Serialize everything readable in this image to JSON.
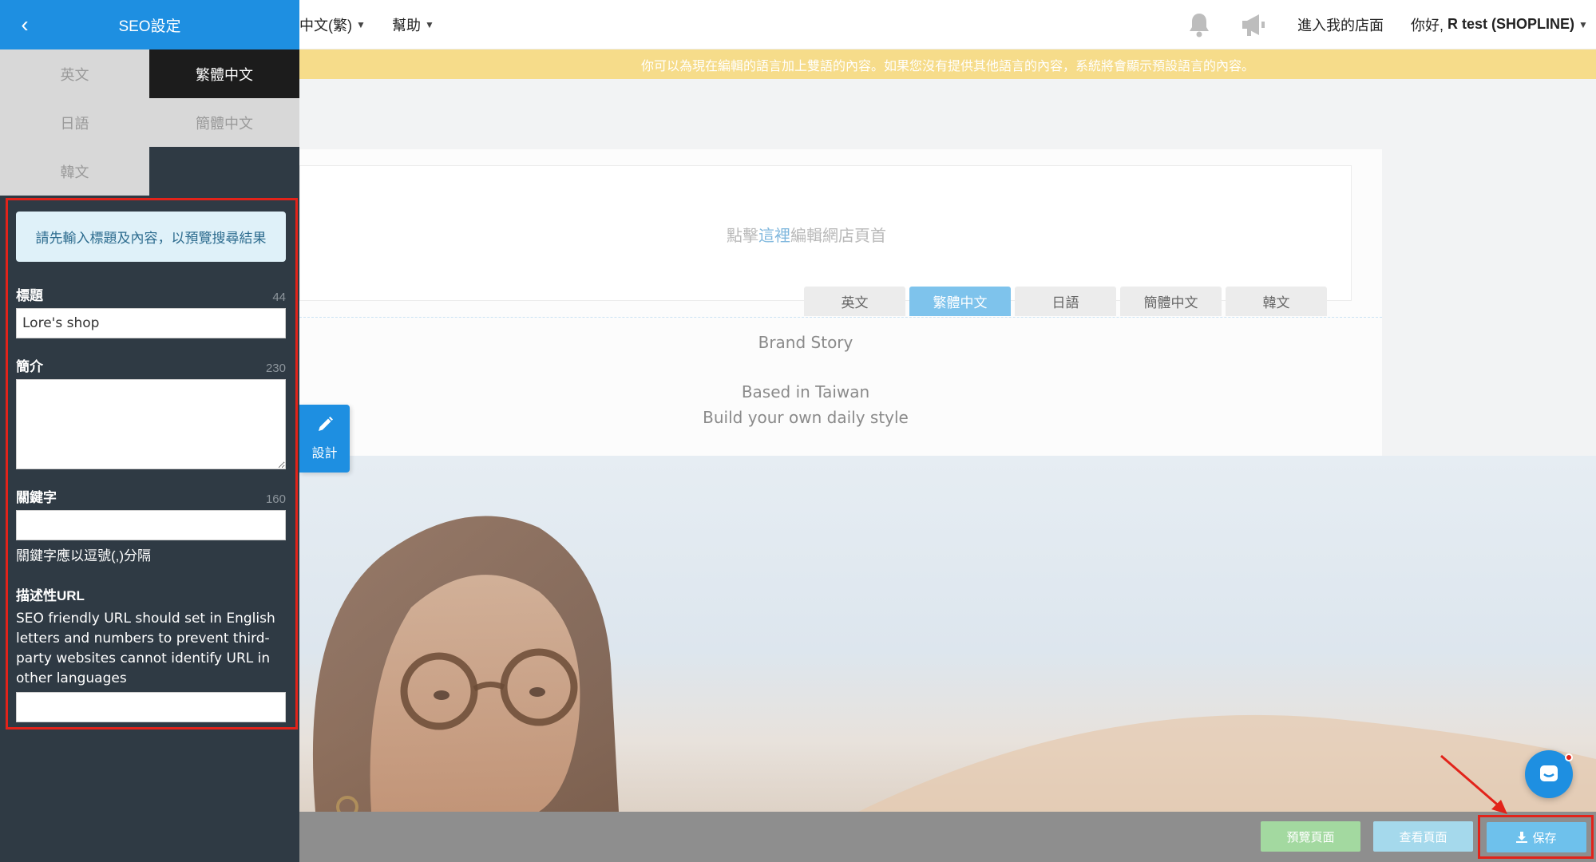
{
  "sidebar": {
    "title": "SEO設定",
    "languages": [
      {
        "label": "英文"
      },
      {
        "label": "繁體中文"
      },
      {
        "label": "日語"
      },
      {
        "label": "簡體中文"
      },
      {
        "label": "韓文"
      }
    ],
    "active_language": "繁體中文",
    "hint": "請先輸入標題及內容，以預覽搜尋結果",
    "fields": {
      "title": {
        "label": "標題",
        "count": "44",
        "value": "Lore's shop"
      },
      "summary": {
        "label": "簡介",
        "count": "230",
        "value": ""
      },
      "keywords": {
        "label": "關鍵字",
        "count": "160",
        "value": "",
        "helper": "關鍵字應以逗號(,)分隔"
      },
      "url": {
        "label": "描述性URL",
        "description": "SEO friendly URL should set in English letters and numbers to prevent third-party websites cannot identify URL in other languages",
        "value": ""
      }
    }
  },
  "topnav": {
    "language": "中文(繁)",
    "help": "幫助",
    "enter_store": "進入我的店面",
    "greeting_prefix": "你好,",
    "user_name": "R test (SHOPLINE)"
  },
  "banner": {
    "text": "你可以為現在編輯的語言加上雙語的內容。如果您沒有提供其他語言的內容，系統將會顯示預設語言的內容。"
  },
  "main": {
    "edit_prefix": "點擊",
    "edit_link": "這裡",
    "edit_suffix": "編輯網店頁首",
    "tabs": [
      {
        "label": "英文"
      },
      {
        "label": "繁體中文"
      },
      {
        "label": "日語"
      },
      {
        "label": "簡體中文"
      },
      {
        "label": "韓文"
      }
    ],
    "story_title": "Brand Story",
    "story_line1": "Based in Taiwan",
    "story_line2": "Build your own daily style",
    "design_label": "設計"
  },
  "bottom": {
    "preview": "預覽頁面",
    "view": "查看頁面",
    "save": "保存"
  },
  "colors": {
    "primary": "#1e8fe1",
    "sidebar_bg": "#2f3a44",
    "highlight": "#e2231a",
    "banner": "#f6dc8a"
  },
  "icons": [
    "chevron-left-icon",
    "bell-icon",
    "megaphone-icon",
    "pencil-icon",
    "download-icon",
    "chat-icon"
  ]
}
